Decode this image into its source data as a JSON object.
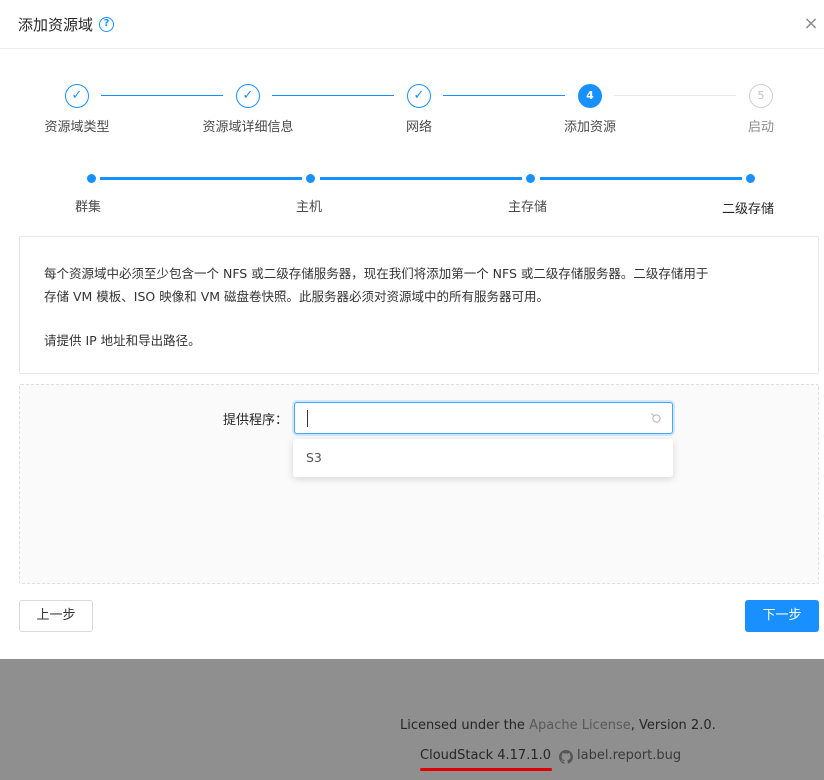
{
  "dialog": {
    "title": "添加资源域",
    "help_icon": "question-circle-icon",
    "close_icon": "×"
  },
  "steps": [
    {
      "label": "资源域类型",
      "status": "done",
      "number": "1"
    },
    {
      "label": "资源域详细信息",
      "status": "done",
      "number": "2"
    },
    {
      "label": "网络",
      "status": "done",
      "number": "3"
    },
    {
      "label": "添加资源",
      "status": "active",
      "number": "4"
    },
    {
      "label": "启动",
      "status": "wait",
      "number": "5"
    }
  ],
  "step_check": "✓",
  "substeps": [
    {
      "label": "群集"
    },
    {
      "label": "主机"
    },
    {
      "label": "主存储"
    },
    {
      "label": "二级存储",
      "active": true
    }
  ],
  "info": {
    "line1": "每个资源域中必须至少包含一个 NFS 或二级存储服务器，现在我们将添加第一个 NFS 或二级存储服务器。二级存储用于",
    "line2": "存储 VM 模板、ISO 映像和 VM 磁盘卷快照。此服务器必须对资源域中的所有服务器可用。",
    "line3": "请提供 IP 地址和导出路径。"
  },
  "form": {
    "provider_label": "提供程序：",
    "provider_value": "",
    "options": [
      "S3"
    ]
  },
  "buttons": {
    "prev": "上一步",
    "next": "下一步"
  },
  "footer": {
    "license_prefix": "Licensed under the ",
    "license_link": "Apache License",
    "license_suffix": ", Version 2.0.",
    "version": "CloudStack 4.17.1.0",
    "report_bug": "label.report.bug"
  },
  "colors": {
    "primary": "#1890ff",
    "overlay": "#8f8f8f",
    "underline": "#e00000"
  }
}
